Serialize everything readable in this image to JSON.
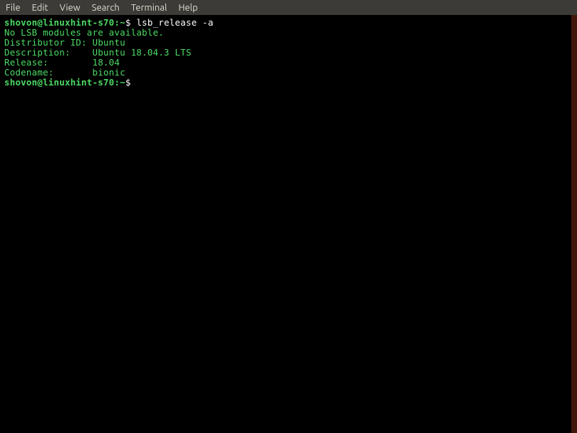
{
  "menubar": {
    "items": [
      "File",
      "Edit",
      "View",
      "Search",
      "Terminal",
      "Help"
    ]
  },
  "terminal": {
    "prompt_user": "shovon@linuxhint-s70",
    "prompt_sep": ":",
    "prompt_path": "~",
    "prompt_dollar": "$",
    "command": "lsb_release -a",
    "output_lines": [
      "No LSB modules are available.",
      "Distributor ID: Ubuntu",
      "Description:    Ubuntu 18.04.3 LTS",
      "Release:        18.04",
      "Codename:       bionic"
    ]
  }
}
